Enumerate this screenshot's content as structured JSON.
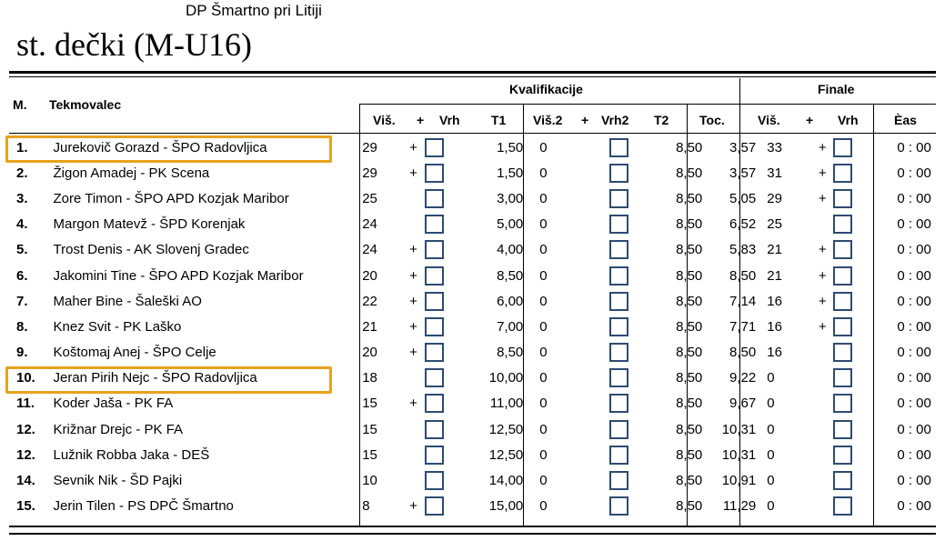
{
  "venue": "DP Šmartno pri Litiji",
  "category": "st. dečki (M-U16)",
  "headers": {
    "rank": "M.",
    "competitor": "Tekmovalec",
    "qualification": "Kvalifikacije",
    "final": "Finale",
    "vis": "Viš.",
    "plus": "+",
    "vrh": "Vrh",
    "t1": "T1",
    "vis2": "Viš.2",
    "plus2": "+",
    "vrh2": "Vrh2",
    "t2": "T2",
    "toc": "Toc.",
    "fvis": "Viš.",
    "fplus": "+",
    "fvrh": "Vrh",
    "cas": "Èas"
  },
  "highlight_color": "#e8a21c",
  "rows": [
    {
      "rank": "1.",
      "name": "Jurekovič Gorazd - ŠPO Radovljica",
      "vis": "29",
      "plus": "+",
      "t1": "1,50",
      "vis2": "0",
      "t2": "8,50",
      "toc": "3,57",
      "fvis": "33",
      "fplus": "+",
      "cas": "0 : 00",
      "highlighted": true
    },
    {
      "rank": "2.",
      "name": "Žigon Amadej - PK Scena",
      "vis": "29",
      "plus": "+",
      "t1": "1,50",
      "vis2": "0",
      "t2": "8,50",
      "toc": "3,57",
      "fvis": "31",
      "fplus": "+",
      "cas": "0 : 00",
      "highlighted": false
    },
    {
      "rank": "3.",
      "name": "Zore Timon - ŠPO APD Kozjak Maribor",
      "vis": "25",
      "plus": "",
      "t1": "3,00",
      "vis2": "0",
      "t2": "8,50",
      "toc": "5,05",
      "fvis": "29",
      "fplus": "+",
      "cas": "0 : 00",
      "highlighted": false
    },
    {
      "rank": "4.",
      "name": "Margon Matevž - ŠPD Korenjak",
      "vis": "24",
      "plus": "",
      "t1": "5,00",
      "vis2": "0",
      "t2": "8,50",
      "toc": "6,52",
      "fvis": "25",
      "fplus": "",
      "cas": "0 : 00",
      "highlighted": false
    },
    {
      "rank": "5.",
      "name": "Trost Denis  - AK Slovenj Gradec",
      "vis": "24",
      "plus": "+",
      "t1": "4,00",
      "vis2": "0",
      "t2": "8,50",
      "toc": "5,83",
      "fvis": "21",
      "fplus": "+",
      "cas": "0 : 00",
      "highlighted": false
    },
    {
      "rank": "6.",
      "name": "Jakomini Tine - ŠPO APD Kozjak Maribor",
      "vis": "20",
      "plus": "+",
      "t1": "8,50",
      "vis2": "0",
      "t2": "8,50",
      "toc": "8,50",
      "fvis": "21",
      "fplus": "+",
      "cas": "0 : 00",
      "highlighted": false
    },
    {
      "rank": "7.",
      "name": "Maher Bine - Šaleški AO",
      "vis": "22",
      "plus": "+",
      "t1": "6,00",
      "vis2": "0",
      "t2": "8,50",
      "toc": "7,14",
      "fvis": "16",
      "fplus": "+",
      "cas": "0 : 00",
      "highlighted": false
    },
    {
      "rank": "8.",
      "name": "Knez Svit - PK Laško",
      "vis": "21",
      "plus": "+",
      "t1": "7,00",
      "vis2": "0",
      "t2": "8,50",
      "toc": "7,71",
      "fvis": "16",
      "fplus": "+",
      "cas": "0 : 00",
      "highlighted": false
    },
    {
      "rank": "9.",
      "name": "Koštomaj Anej - ŠPO Celje",
      "vis": "20",
      "plus": "+",
      "t1": "8,50",
      "vis2": "0",
      "t2": "8,50",
      "toc": "8,50",
      "fvis": "16",
      "fplus": "",
      "cas": "0 : 00",
      "highlighted": false
    },
    {
      "rank": "10.",
      "name": "Jeran Pirih Nejc - ŠPO Radovljica",
      "vis": "18",
      "plus": "",
      "t1": "10,00",
      "vis2": "0",
      "t2": "8,50",
      "toc": "9,22",
      "fvis": "0",
      "fplus": "",
      "cas": "0 : 00",
      "highlighted": true
    },
    {
      "rank": "11.",
      "name": "Koder Jaša - PK FA",
      "vis": "15",
      "plus": "+",
      "t1": "11,00",
      "vis2": "0",
      "t2": "8,50",
      "toc": "9,67",
      "fvis": "0",
      "fplus": "",
      "cas": "0 : 00",
      "highlighted": false
    },
    {
      "rank": "12.",
      "name": "Križnar Drejc - PK FA",
      "vis": "15",
      "plus": "",
      "t1": "12,50",
      "vis2": "0",
      "t2": "8,50",
      "toc": "10,31",
      "fvis": "0",
      "fplus": "",
      "cas": "0 : 00",
      "highlighted": false
    },
    {
      "rank": "12.",
      "name": "Lužnik Robba Jaka - DEŠ",
      "vis": "15",
      "plus": "",
      "t1": "12,50",
      "vis2": "0",
      "t2": "8,50",
      "toc": "10,31",
      "fvis": "0",
      "fplus": "",
      "cas": "0 : 00",
      "highlighted": false
    },
    {
      "rank": "14.",
      "name": "Sevnik Nik - ŠD Pajki",
      "vis": "10",
      "plus": "",
      "t1": "14,00",
      "vis2": "0",
      "t2": "8,50",
      "toc": "10,91",
      "fvis": "0",
      "fplus": "",
      "cas": "0 : 00",
      "highlighted": false
    },
    {
      "rank": "15.",
      "name": "Jerin Tilen - PS DPČ Šmartno",
      "vis": "8",
      "plus": "+",
      "t1": "15,00",
      "vis2": "0",
      "t2": "8,50",
      "toc": "11,29",
      "fvis": "0",
      "fplus": "",
      "cas": "0 : 00",
      "highlighted": false
    }
  ]
}
